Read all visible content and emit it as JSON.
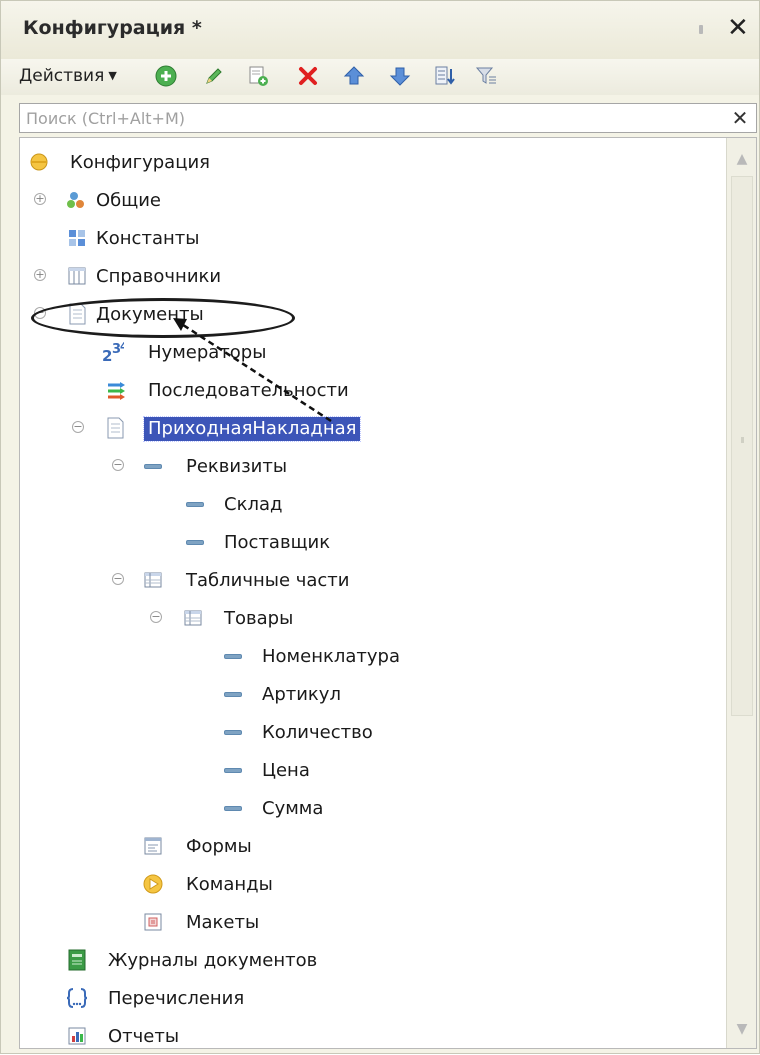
{
  "panel": {
    "title": "Конфигурация *"
  },
  "toolbar": {
    "actions_label": "Действия"
  },
  "search": {
    "placeholder": "Поиск (Ctrl+Alt+M)"
  },
  "tree": {
    "root": "Конфигурация",
    "common": "Общие",
    "constants": "Константы",
    "catalogs": "Справочники",
    "documents": "Документы",
    "numerators": "Нумераторы",
    "sequences": "Последовательности",
    "doc_name": "ПриходнаяНакладная",
    "attributes": "Реквизиты",
    "attr_sklad": "Склад",
    "attr_supplier": "Поставщик",
    "tabular_parts": "Табличные части",
    "goods": "Товары",
    "col_nomenclature": "Номенклатура",
    "col_article": "Артикул",
    "col_quantity": "Количество",
    "col_price": "Цена",
    "col_sum": "Сумма",
    "forms": "Формы",
    "commands": "Команды",
    "templates": "Макеты",
    "doc_journals": "Журналы документов",
    "enums": "Перечисления",
    "reports": "Отчеты"
  },
  "icons": {
    "add": "add-icon",
    "edit": "edit-icon",
    "copy": "copy-icon",
    "delete": "delete-icon",
    "up": "arrow-up-icon",
    "down": "arrow-down-icon",
    "sort": "sort-icon",
    "filter": "filter-icon"
  },
  "colors": {
    "selection": "#3c55b8",
    "accent_green": "#4caf50",
    "delete_red": "#e02020"
  }
}
